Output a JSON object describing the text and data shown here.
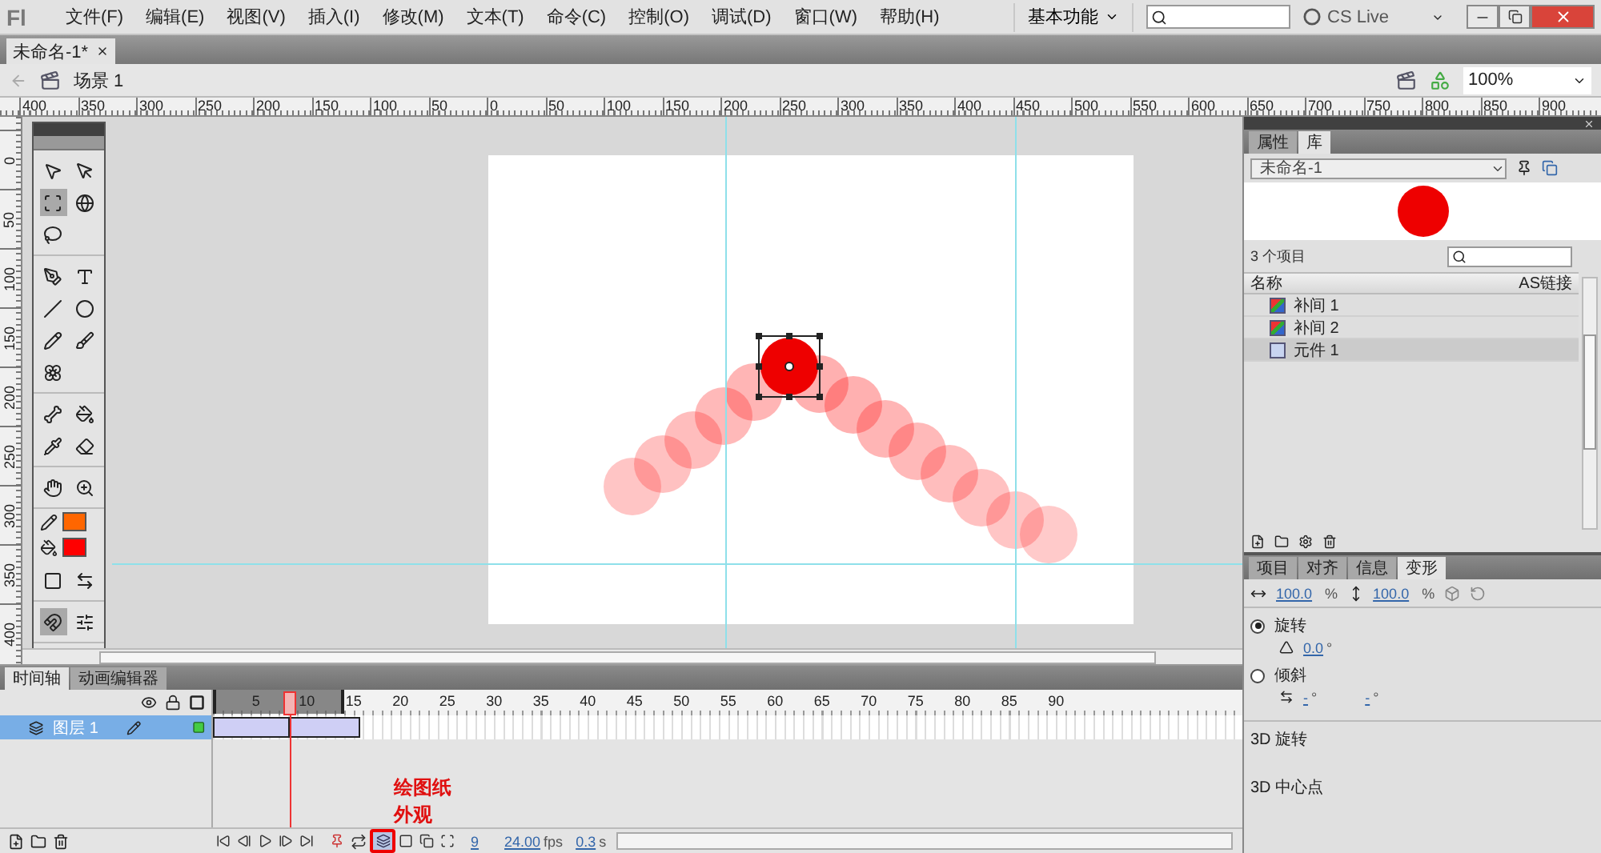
{
  "menu_bar": {
    "logo": "Fl",
    "items": [
      "文件(F)",
      "编辑(E)",
      "视图(V)",
      "插入(I)",
      "修改(M)",
      "文本(T)",
      "命令(C)",
      "控制(O)",
      "调试(D)",
      "窗口(W)",
      "帮助(H)"
    ],
    "workspace": "基本功能",
    "cs_live": "CS Live"
  },
  "document_tabs": [
    {
      "label": "未命名-1*",
      "selected": true
    }
  ],
  "edit_bar": {
    "scene": "场景 1",
    "zoom": "100%"
  },
  "rulers": {
    "horizontal": [
      "400",
      "350",
      "300",
      "250",
      "200",
      "150",
      "100",
      "50",
      "0",
      "50",
      "100",
      "150",
      "200",
      "250",
      "300",
      "350",
      "400",
      "450",
      "500",
      "550",
      "600",
      "650",
      "700",
      "750",
      "800",
      "850",
      "900"
    ],
    "vertical": [
      "0",
      "50",
      "100",
      "150",
      "200",
      "250",
      "300",
      "350",
      "400"
    ]
  },
  "tools": {
    "groups": [
      [
        {
          "selected": false
        },
        {
          "selected": false
        },
        {
          "selected": true
        },
        {
          "selected": false
        },
        {
          "selected": false
        }
      ],
      [
        {
          "selected": false
        },
        {
          "selected": false
        },
        {
          "selected": false
        },
        {
          "selected": false
        },
        {
          "selected": false
        },
        {
          "selected": false
        },
        {
          "selected": false
        }
      ],
      [
        {
          "selected": false
        },
        {
          "selected": false
        },
        {
          "selected": false
        },
        {
          "selected": false
        }
      ],
      [
        {
          "selected": false
        },
        {
          "selected": false
        }
      ],
      [
        {
          "selected": false
        },
        {
          "selected": false
        }
      ],
      [
        {
          "selected": true
        },
        {
          "selected": false
        }
      ]
    ],
    "swatches": [
      {
        "kind": "stroke",
        "color": "#ff6600"
      },
      {
        "kind": "fill",
        "color": "#ff0000"
      }
    ]
  },
  "timeline": {
    "tabs": [
      {
        "label": "时间轴",
        "selected": true
      },
      {
        "label": "动画编辑器",
        "selected": false
      }
    ],
    "frame_numbers": [
      "5",
      "10",
      "15",
      "20",
      "25",
      "30",
      "35",
      "40",
      "45",
      "50",
      "55",
      "60",
      "65",
      "70",
      "75",
      "80",
      "85",
      "90"
    ],
    "layers": [
      {
        "name": "图层 1",
        "selected": true
      }
    ],
    "onion_skin": {
      "on": true
    },
    "current_frame": "9",
    "frame_rate": "24.00",
    "frame_rate_unit": "fps",
    "elapsed": "0.3",
    "elapsed_unit": "s",
    "annotation": "绘图纸外观"
  },
  "library_panel": {
    "tabs": [
      {
        "label": "属性",
        "selected": false
      },
      {
        "label": "库",
        "selected": true
      }
    ],
    "document": "未命名-1",
    "item_count": "3 个项目",
    "columns": [
      "名称",
      "AS链接"
    ],
    "items": [
      {
        "name": "补间 1",
        "kind": "tween",
        "selected": false
      },
      {
        "name": "补间 2",
        "kind": "tween",
        "selected": false
      },
      {
        "name": "元件 1",
        "kind": "graphic",
        "selected": true
      }
    ]
  },
  "transform_panel": {
    "tabs": [
      {
        "label": "项目",
        "selected": false
      },
      {
        "label": "对齐",
        "selected": false
      },
      {
        "label": "信息",
        "selected": false
      },
      {
        "label": "变形",
        "selected": true
      }
    ],
    "scale": [
      {
        "value": "100.0",
        "unit": "%"
      },
      {
        "value": "100.0",
        "unit": "%"
      }
    ],
    "options": [
      {
        "label": "旋转",
        "selected": true,
        "fields": [
          {
            "value": "0.0",
            "unit": "°"
          }
        ]
      },
      {
        "label": "倾斜",
        "selected": false,
        "fields": [
          {
            "value": "-",
            "unit": "°"
          },
          {
            "value": "-",
            "unit": "°"
          }
        ]
      }
    ],
    "sections": [
      "3D 旋转",
      "3D 中心点"
    ]
  }
}
